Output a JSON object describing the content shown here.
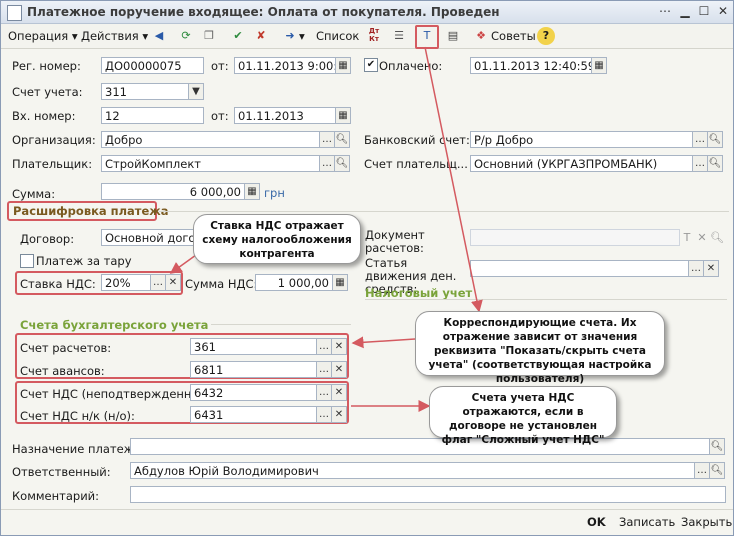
{
  "window": {
    "title": "Платежное поручение входящее: Оплата от покупателя. Проведен"
  },
  "toolbar": {
    "operation": "Операция",
    "actions": "Действия",
    "list": "Список",
    "dtkt": "Дт Кт",
    "tips": "Советы"
  },
  "form": {
    "reg_label": "Рег. номер:",
    "reg_value": "ДО00000075",
    "from_label": "от:",
    "reg_date": "01.11.2013  9:00:00",
    "paid_label": "Оплачено:",
    "paid_date": "01.11.2013 12:40:59",
    "account_label": "Счет учета:",
    "account_value": "311",
    "incoming_label": "Вх. номер:",
    "incoming_value": "12",
    "incoming_date": "01.11.2013",
    "org_label": "Организация:",
    "org_value": "Добро",
    "bank_label": "Банковский счет:",
    "bank_value": "Р/р Добро",
    "payer_label": "Плательщик:",
    "payer_value": "СтройКомплект",
    "payer_acc_label": "Счет плательщ...",
    "payer_acc_value": "Основний (УКРГАЗПРОМБАНК)",
    "sum_label": "Сумма:",
    "sum_value": "6 000,00",
    "currency": "грн"
  },
  "details": {
    "title": "Расшифровка платежа",
    "contract_label": "Договор:",
    "contract_value": "Основной догово",
    "tare_label": "Платеж за тару",
    "vat_rate_label": "Ставка НДС:",
    "vat_rate_value": "20%",
    "vat_sum_label": "Сумма НДС:",
    "vat_sum_value": "1 000,00",
    "doc_label": "Документ расчетов:",
    "cashflow_label": "Статья движения ден. средств:",
    "tax_title": "Налоговый учет",
    "accounting_title": "Счета бухгалтерского учета",
    "settle_label": "Счет расчетов:",
    "settle_value": "361",
    "advance_label": "Счет авансов:",
    "advance_value": "6811",
    "vat_unconf_label": "Счет НДС (неподтвержденный):",
    "vat_unconf_value": "6432",
    "vat_nk_label": "Счет НДС н/к (н/о):",
    "vat_nk_value": "6431"
  },
  "bottom": {
    "purpose_label": "Назначение платежа:",
    "responsible_label": "Ответственный:",
    "responsible_value": "Абдулов Юрій Володимирович",
    "comment_label": "Комментарий:"
  },
  "footer": {
    "ok": "OK",
    "save": "Записать",
    "close": "Закрыть"
  },
  "callouts": {
    "vat": "Ставка НДС отражает схему налогообложения контрагента",
    "corr": "Корреспондирующие счета. Их отражение зависит от значения реквизита \"Показать/скрыть счета учета\" (соответствующая настройка пользователя)",
    "vat_acc": "Счета учета НДС отражаются, если в договоре не установлен флаг \"Сложный учет НДС\""
  },
  "colors": {
    "accent_green": "#7aa33a",
    "highlight_red": "#d45a60"
  }
}
